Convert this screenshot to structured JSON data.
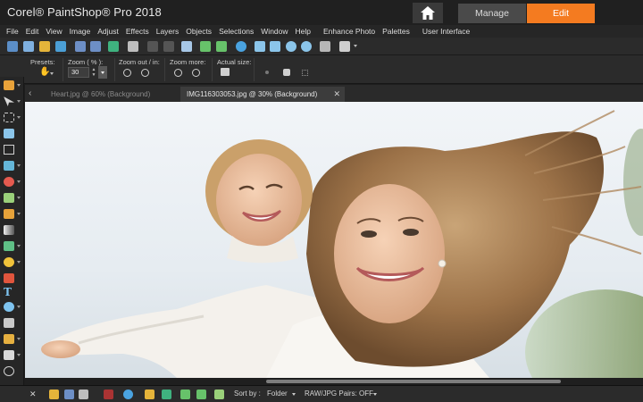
{
  "titlebar": {
    "app_title": "Corel® PaintShop® Pro 2018",
    "workspaces": {
      "manage": "Manage",
      "edit": "Edit"
    }
  },
  "menu": [
    "File",
    "Edit",
    "View",
    "Image",
    "Adjust",
    "Effects",
    "Layers",
    "Objects",
    "Selections",
    "Window",
    "Help",
    "Enhance Photo",
    "Palettes",
    "User Interface"
  ],
  "options": {
    "presets_label": "Presets:",
    "zoom_label": "Zoom ( % ):",
    "zoom_value": "30",
    "zoom_out_in_label": "Zoom out / in:",
    "zoom_more_label": "Zoom more:",
    "actual_size_label": "Actual size:"
  },
  "tabs": [
    {
      "label": "Heart.jpg @  60% (Background)",
      "active": false
    },
    {
      "label": "IMG116303053.jpg @  30% (Background)",
      "active": true
    }
  ],
  "organizer": {
    "sort_label": "Sort by :",
    "sort_value": "Folder",
    "raw_pairs": "RAW/JPG Pairs: OFF"
  },
  "colors": {
    "accent": "#f47b20",
    "chrome_dark": "#202020",
    "panel": "#2b2b2b"
  }
}
